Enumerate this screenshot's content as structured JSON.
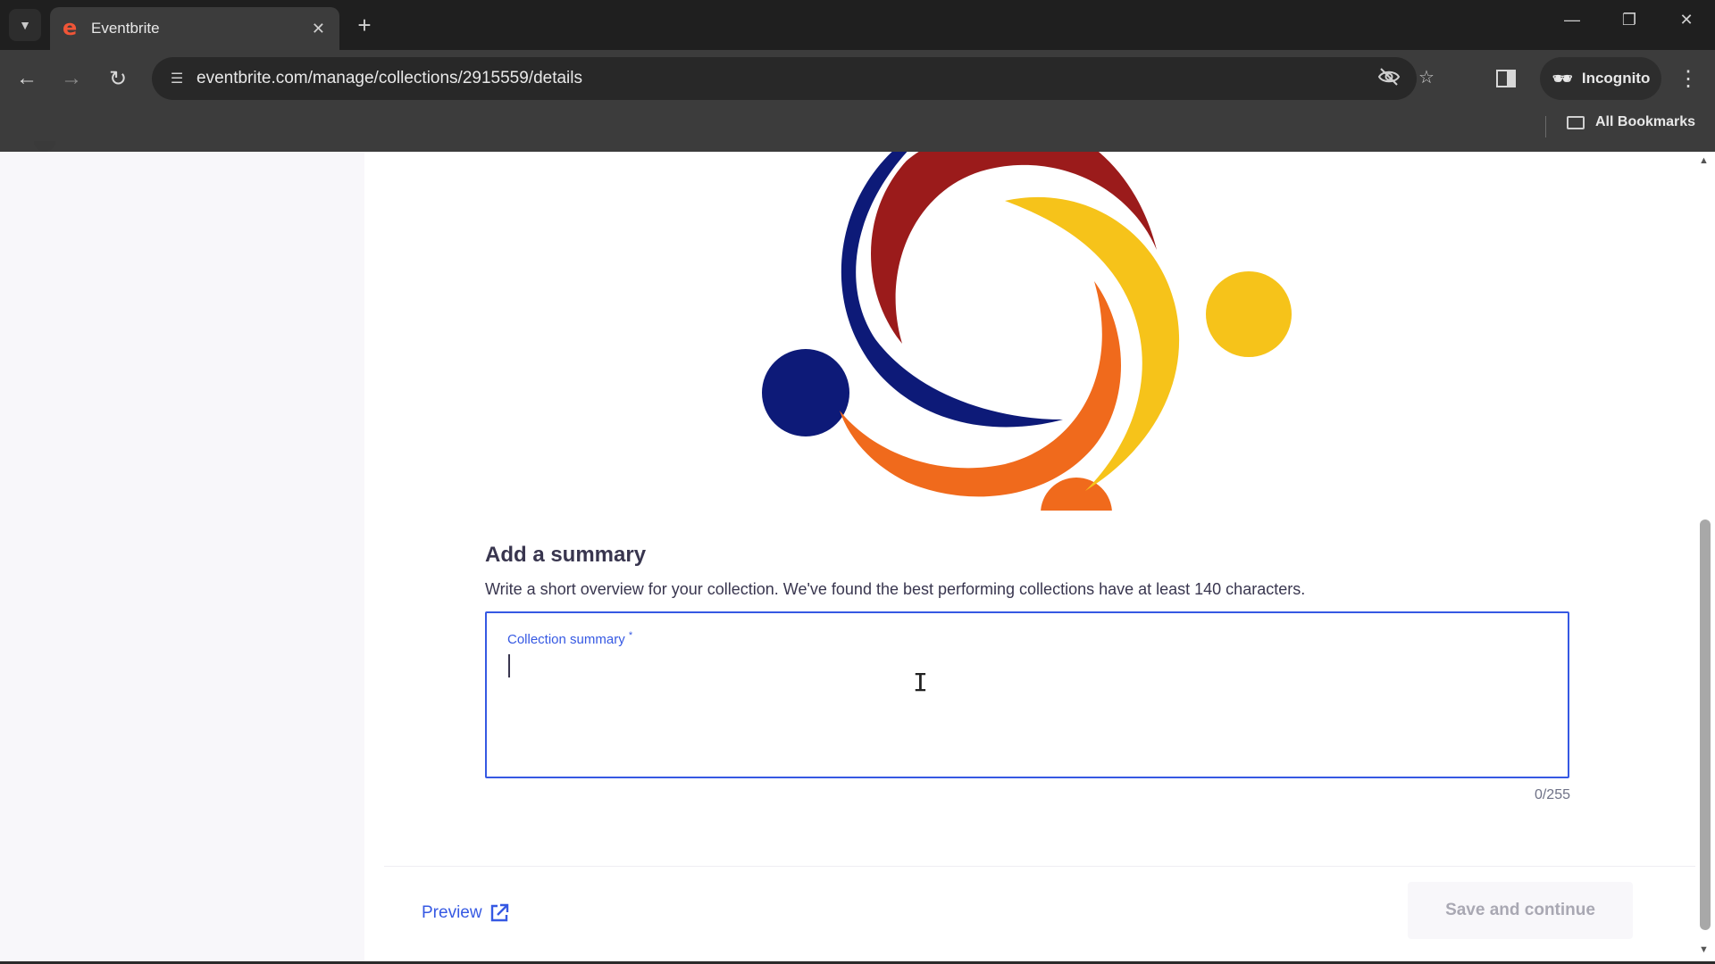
{
  "browser": {
    "tab_title": "Eventbrite",
    "favicon": "e",
    "url": "eventbrite.com/manage/collections/2915559/details",
    "incognito_label": "Incognito",
    "all_bookmarks_label": "All Bookmarks",
    "icons": {
      "tab_search": "chevron-down-icon",
      "close_tab": "close-icon",
      "new_tab": "plus-icon",
      "back": "arrow-left-icon",
      "forward": "arrow-right-icon",
      "reload": "reload-icon",
      "site_info": "tune-icon",
      "tracking": "eye-off-icon",
      "bookmark": "star-icon",
      "side_panel": "side-panel-icon",
      "menu": "more-vertical-icon"
    }
  },
  "summary": {
    "heading": "Add a summary",
    "description": "Write a short overview for your collection. We've found the best performing collections have at least 140 characters.",
    "field_label": "Collection summary",
    "required_mark": "*",
    "value": "",
    "char_count": "0/255"
  },
  "footer": {
    "preview_label": "Preview",
    "save_label": "Save and continue"
  },
  "colors": {
    "accent": "#3659e3",
    "text": "#39364f",
    "logo_navy": "#0d1a78",
    "logo_red": "#9b1b1b",
    "logo_yellow": "#f6c31a",
    "logo_orange": "#f06a1c"
  }
}
